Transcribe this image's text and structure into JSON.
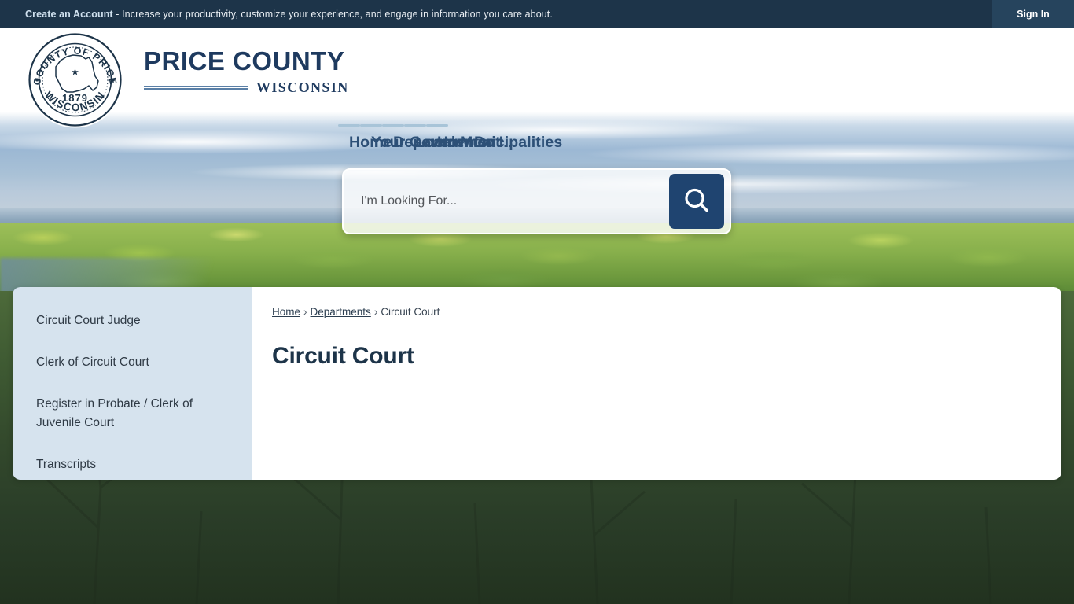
{
  "topbar": {
    "cta_bold": "Create an Account",
    "cta_rest": " - Increase your productivity, customize your experience, and engage in information you care about.",
    "signin_label": "Sign In"
  },
  "brand": {
    "seal_top_text": "COUNTY OF PRICE",
    "seal_bottom_text": "WISCONSIN",
    "seal_year": "1879",
    "wordmark_main": "PRICE COUNTY",
    "wordmark_sub": "WISCONSIN"
  },
  "nav": {
    "items": [
      {
        "label": "Home"
      },
      {
        "label": "Your Government"
      },
      {
        "label": "Departments"
      },
      {
        "label": "Local Municipalities"
      },
      {
        "label": "How Do I..."
      }
    ]
  },
  "search": {
    "placeholder": "I'm Looking For...",
    "value": "",
    "button_icon": "search-icon"
  },
  "sidebar": {
    "items": [
      {
        "label": "Circuit Court Judge"
      },
      {
        "label": "Clerk of Circuit Court"
      },
      {
        "label": "Register in Probate / Clerk of Juvenile Court"
      },
      {
        "label": "Transcripts"
      }
    ]
  },
  "breadcrumb": {
    "items": [
      {
        "label": "Home",
        "link": true
      },
      {
        "label": "Departments",
        "link": true
      },
      {
        "label": "Circuit Court",
        "link": false
      }
    ],
    "separator": "›"
  },
  "main": {
    "page_title": "Circuit Court"
  },
  "colors": {
    "topbar_bg": "#1d3449",
    "signin_bg": "#26445d",
    "brand_navy": "#1e3a5f",
    "nav_text": "#2d5077",
    "nav_underline": "#a8c4d8",
    "sidebar_bg": "#d6e3ee",
    "search_button_bg": "#1f4470",
    "card_bg": "#ffffff"
  }
}
